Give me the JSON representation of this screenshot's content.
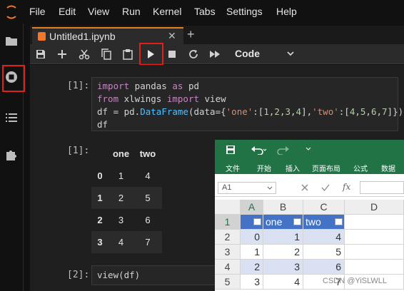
{
  "menubar": {
    "items": [
      "File",
      "Edit",
      "View",
      "Run",
      "Kernel",
      "Tabs",
      "Settings",
      "Help"
    ]
  },
  "sidebar": {
    "icons": [
      "folder-icon",
      "running-kernels-icon",
      "toc-icon",
      "extension-icon"
    ]
  },
  "tab": {
    "label": "Untitled1.ipynb",
    "close": "✕",
    "add": "+"
  },
  "toolbar": {
    "cell_type": "Code"
  },
  "cells": [
    {
      "prompt": "[1]:",
      "code": [
        "import pandas as pd",
        "from xlwings import view",
        "df = pd.DataFrame(data={'one':[1,2,3,4],'two':[4,5,6,7]})",
        "df"
      ]
    },
    {
      "prompt": "[1]:",
      "table": {
        "columns": [
          "one",
          "two"
        ],
        "rows": [
          [
            "0",
            "1",
            "4"
          ],
          [
            "1",
            "2",
            "5"
          ],
          [
            "2",
            "3",
            "6"
          ],
          [
            "3",
            "4",
            "7"
          ]
        ]
      }
    },
    {
      "prompt": "[2]:",
      "code": [
        "view(df)"
      ]
    }
  ],
  "excel": {
    "ribbon_tabs": [
      "文件",
      "开始",
      "插入",
      "页面布局",
      "公式",
      "数据"
    ],
    "name_box": "A1",
    "fx": "fx",
    "col_headers": [
      "A",
      "B",
      "C",
      "D"
    ],
    "row_headers": [
      "1",
      "2",
      "3",
      "4",
      "5"
    ],
    "header_row": [
      "",
      "one",
      "two"
    ],
    "data": [
      [
        "0",
        "1",
        "4"
      ],
      [
        "1",
        "2",
        "5"
      ],
      [
        "2",
        "3",
        "6"
      ],
      [
        "3",
        "4",
        "7"
      ]
    ]
  },
  "watermark": "CSDN @YiSLWLL",
  "colors": {
    "accent_orange": "#f37726",
    "highlight_red": "#e0201a",
    "excel_green": "#217346",
    "table_blue": "#4472c4"
  }
}
